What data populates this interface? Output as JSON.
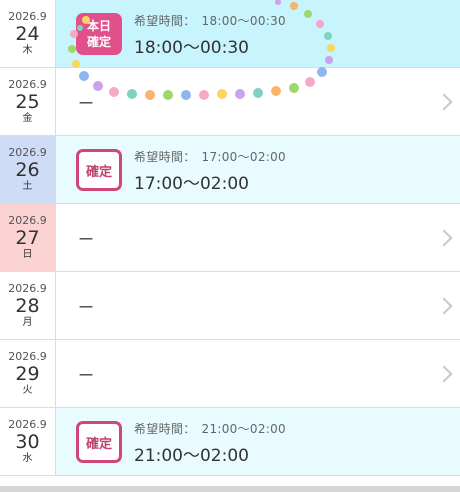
{
  "labels": {
    "hope": "希望時間：",
    "confirmed": "確定",
    "today_line1": "本日",
    "today_line2": "確定"
  },
  "colors": {
    "today_bg": "#c7f4fd",
    "shift_bg": "#e8fbff",
    "badge": "#d0457a",
    "saturday": "#cfdcf6",
    "sunday": "#fcd3d3"
  },
  "rows": [
    {
      "ym": "2026.9",
      "day": "24",
      "weekday": "木",
      "status": "today",
      "hope_time": "18:00〜00:30",
      "shift_time": "18:00〜00:30"
    },
    {
      "ym": "2026.9",
      "day": "25",
      "weekday": "金",
      "status": "none",
      "placeholder": "ー"
    },
    {
      "ym": "2026.9",
      "day": "26",
      "weekday": "土",
      "status": "confirmed",
      "hope_time": "17:00〜02:00",
      "shift_time": "17:00〜02:00"
    },
    {
      "ym": "2026.9",
      "day": "27",
      "weekday": "日",
      "status": "none",
      "placeholder": "ー"
    },
    {
      "ym": "2026.9",
      "day": "28",
      "weekday": "月",
      "status": "none",
      "placeholder": "ー"
    },
    {
      "ym": "2026.9",
      "day": "29",
      "weekday": "火",
      "status": "none",
      "placeholder": "ー"
    },
    {
      "ym": "2026.9",
      "day": "30",
      "weekday": "水",
      "status": "confirmed",
      "hope_time": "21:00〜02:00",
      "shift_time": "21:00〜02:00"
    }
  ]
}
